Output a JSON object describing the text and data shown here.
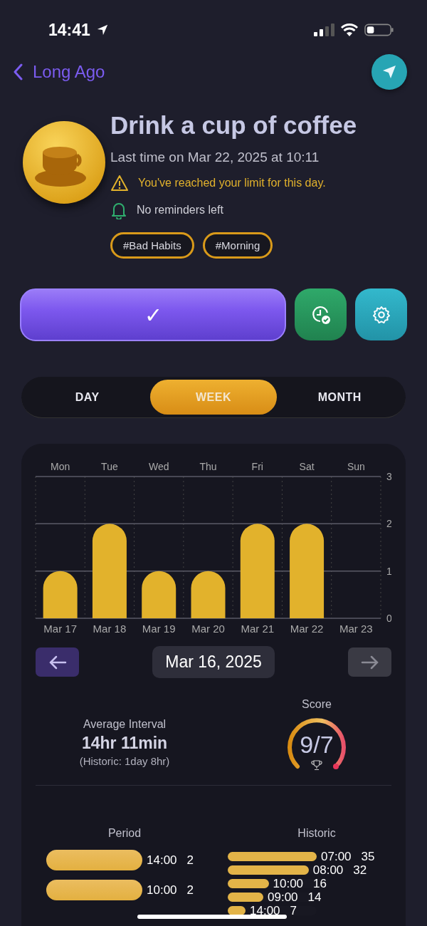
{
  "status_bar": {
    "time": "14:41"
  },
  "nav": {
    "back_label": "Long Ago"
  },
  "habit": {
    "title": "Drink a cup of coffee",
    "last_time": "Last time on Mar 22, 2025 at 10:11",
    "notices": [
      {
        "kind": "warning",
        "text": "You've reached your limit for this day."
      },
      {
        "kind": "reminder",
        "text": "No reminders left"
      }
    ],
    "tags": [
      "#Bad Habits",
      "#Morning"
    ]
  },
  "actions": {
    "done_label": "✓"
  },
  "tabs": [
    {
      "label": "DAY",
      "selected": false
    },
    {
      "label": "WEEK",
      "selected": true
    },
    {
      "label": "MONTH",
      "selected": false
    }
  ],
  "chart": {
    "day_labels": [
      "Mon",
      "Tue",
      "Wed",
      "Thu",
      "Fri",
      "Sat",
      "Sun"
    ],
    "chart_data": {
      "type": "bar",
      "categories": [
        "Mar 17",
        "Mar 18",
        "Mar 19",
        "Mar 20",
        "Mar 21",
        "Mar 22",
        "Mar 23"
      ],
      "values": [
        1,
        2,
        1,
        1,
        2,
        2,
        0
      ],
      "ylim": [
        0,
        3
      ],
      "yticks": [
        0,
        1,
        2,
        3
      ]
    },
    "range_label": "Mar 16, 2025"
  },
  "stats": {
    "interval_label": "Average Interval",
    "interval_value": "14hr 11min",
    "interval_historic": "(Historic: 1day 8hr)",
    "score_label": "Score",
    "score_value": "9/7"
  },
  "period": {
    "title": "Period",
    "rows": [
      {
        "time": "14:00",
        "count": "2",
        "level": 1
      },
      {
        "time": "10:00",
        "count": "2",
        "level": 1
      }
    ]
  },
  "historic": {
    "title": "Historic",
    "rows": [
      {
        "time": "07:00",
        "count": "35",
        "level": 1
      },
      {
        "time": "08:00",
        "count": "32",
        "level": 0.91
      },
      {
        "time": "10:00",
        "count": "16",
        "level": 0.46
      },
      {
        "time": "09:00",
        "count": "14",
        "level": 0.4
      },
      {
        "time": "14:00",
        "count": "7",
        "level": 0.2
      }
    ]
  }
}
